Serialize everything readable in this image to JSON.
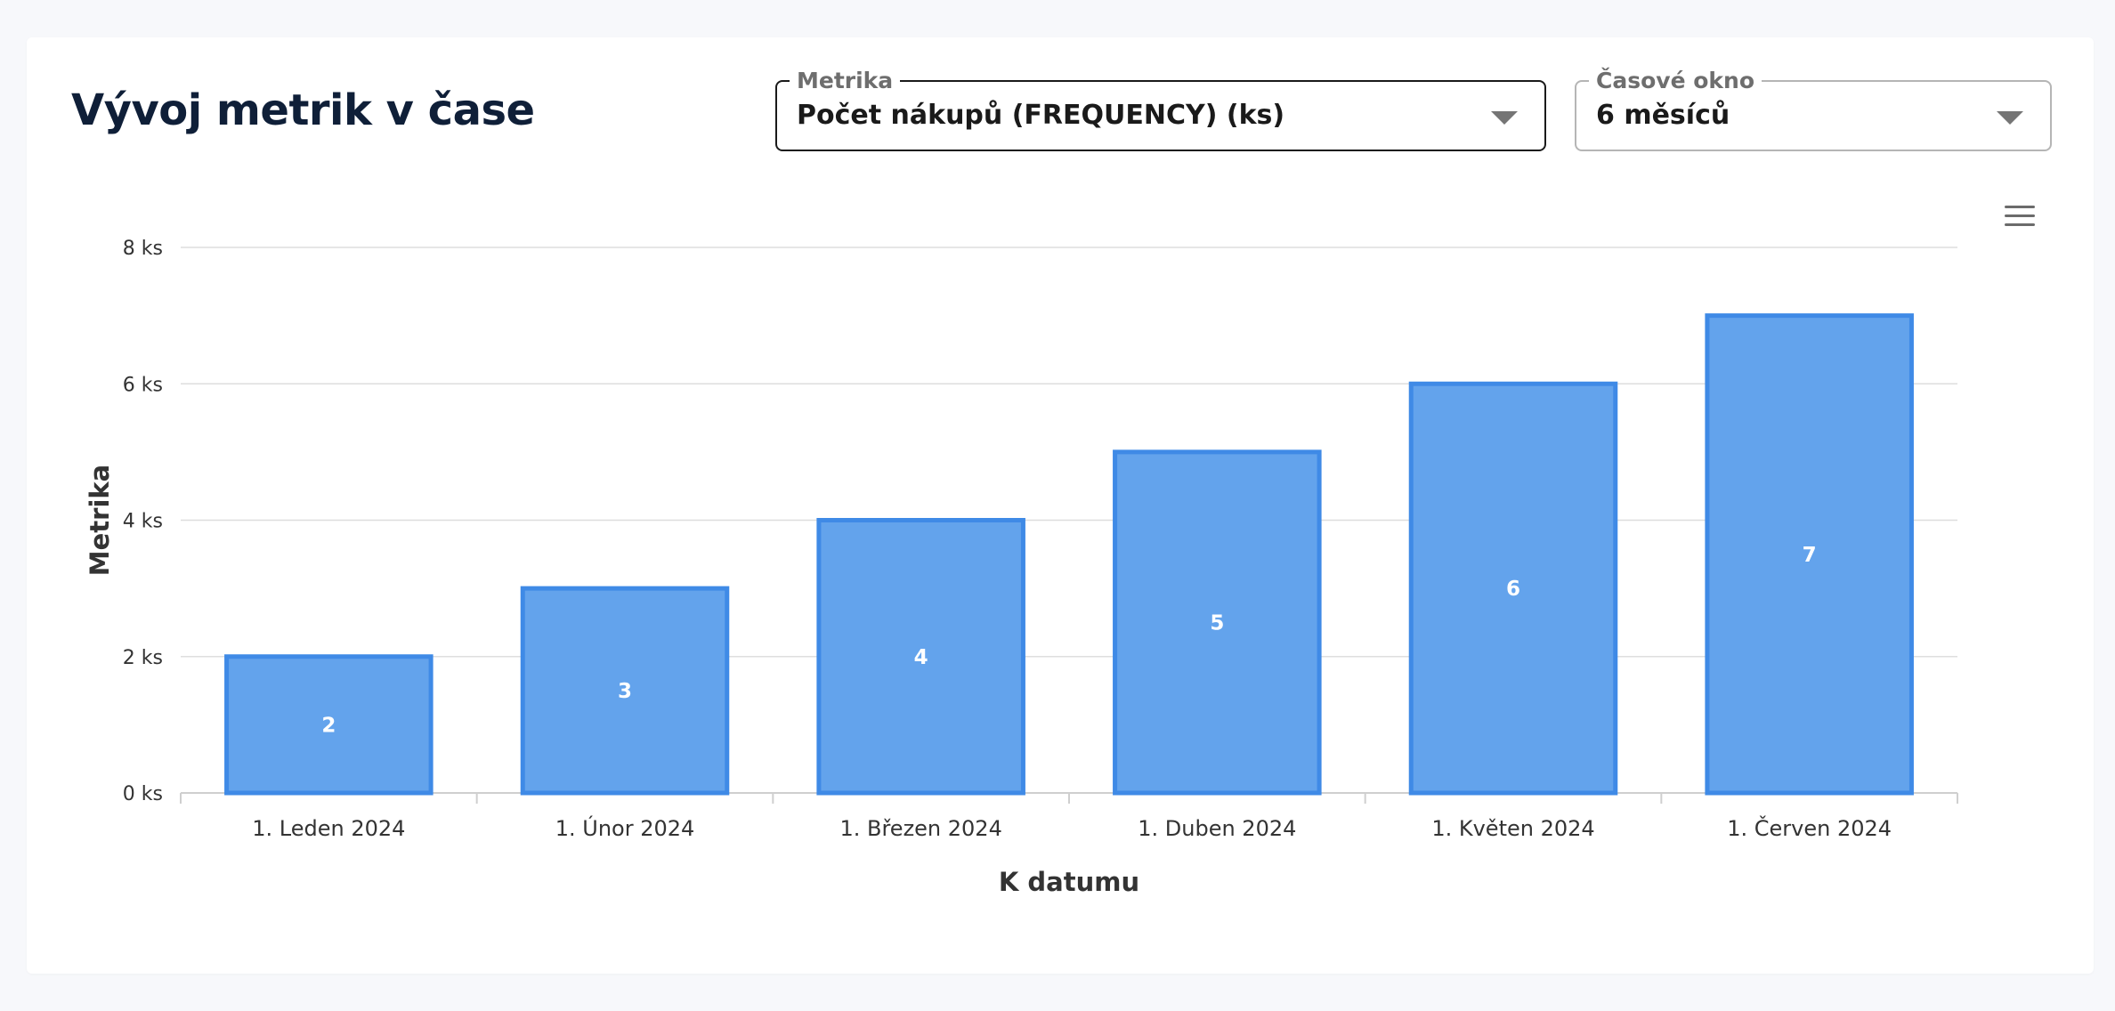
{
  "header": {
    "title": "Vývoj metrik v čase"
  },
  "filters": {
    "metric": {
      "label": "Metrika",
      "value": "Počet nákupů (FREQUENCY) (ks)"
    },
    "time_window": {
      "label": "Časové okno",
      "value": "6 měsíců"
    }
  },
  "toolbar": {
    "menu_icon": "hamburger-menu-icon"
  },
  "colors": {
    "bar_fill": "#63a3ec",
    "bar_stroke": "#3f8ae6",
    "grid": "#dedede",
    "axis": "#cfcfcf"
  },
  "chart_data": {
    "type": "bar",
    "categories": [
      "1. Leden 2024",
      "1. Únor 2024",
      "1. Březen 2024",
      "1. Duben 2024",
      "1. Květen 2024",
      "1. Červen 2024"
    ],
    "values": [
      2,
      3,
      4,
      5,
      6,
      7
    ],
    "data_labels": [
      "2",
      "3",
      "4",
      "5",
      "6",
      "7"
    ],
    "xlabel": "K datumu",
    "ylabel": "Metrika",
    "ylim": [
      0,
      8
    ],
    "yticks": [
      0,
      2,
      4,
      6,
      8
    ],
    "ytick_labels": [
      "0 ks",
      "2 ks",
      "4 ks",
      "6 ks",
      "8 ks"
    ],
    "grid": true,
    "legend": "none"
  }
}
